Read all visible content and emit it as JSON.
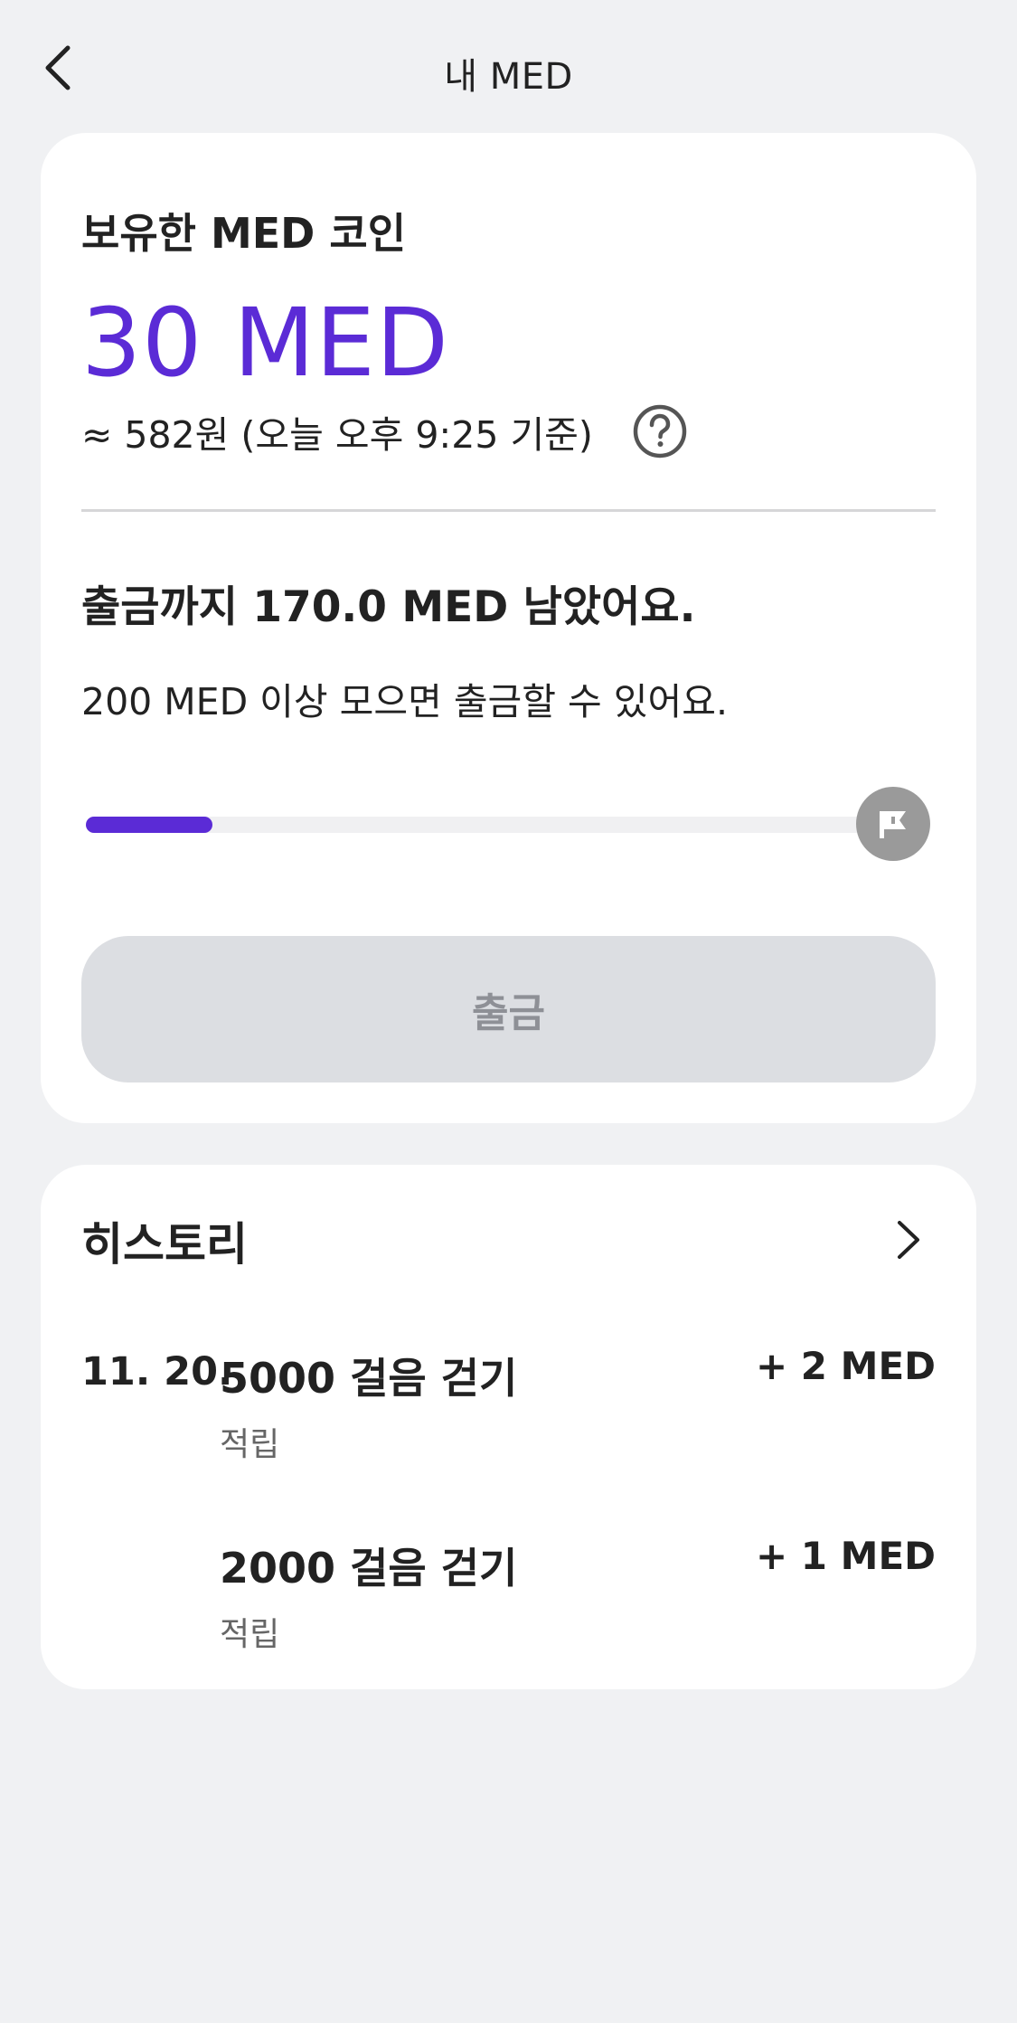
{
  "header": {
    "title": "내 MED"
  },
  "balance": {
    "label": "보유한 MED 코인",
    "value": "30 MED",
    "krw_estimate": "≈ 582원 (오늘 오후 9:25 기준)"
  },
  "withdraw": {
    "remaining_text": "출금까지 170.0 MED 남았어요.",
    "condition_text": "200 MED 이상 모으면 출금할 수 있어요.",
    "progress_fraction": 0.15,
    "button_label": "출금",
    "button_enabled": false
  },
  "history": {
    "title": "히스토리",
    "entries": [
      {
        "date": "11. 20.",
        "name": "5000 걸음 걷기",
        "type": "적립",
        "amount": "+ 2 MED"
      },
      {
        "date": "",
        "name": "2000 걸음 걷기",
        "type": "적립",
        "amount": "+ 1 MED"
      }
    ]
  },
  "colors": {
    "accent": "#5b2bd6",
    "background": "#f0f1f3",
    "card": "#ffffff",
    "button_disabled": "#dcdee2",
    "flag_bg": "#9a9a9a"
  },
  "icons": {
    "back": "chevron-left-icon",
    "help": "question-circle-icon",
    "goal": "flag-icon",
    "history_more": "chevron-right-icon"
  }
}
